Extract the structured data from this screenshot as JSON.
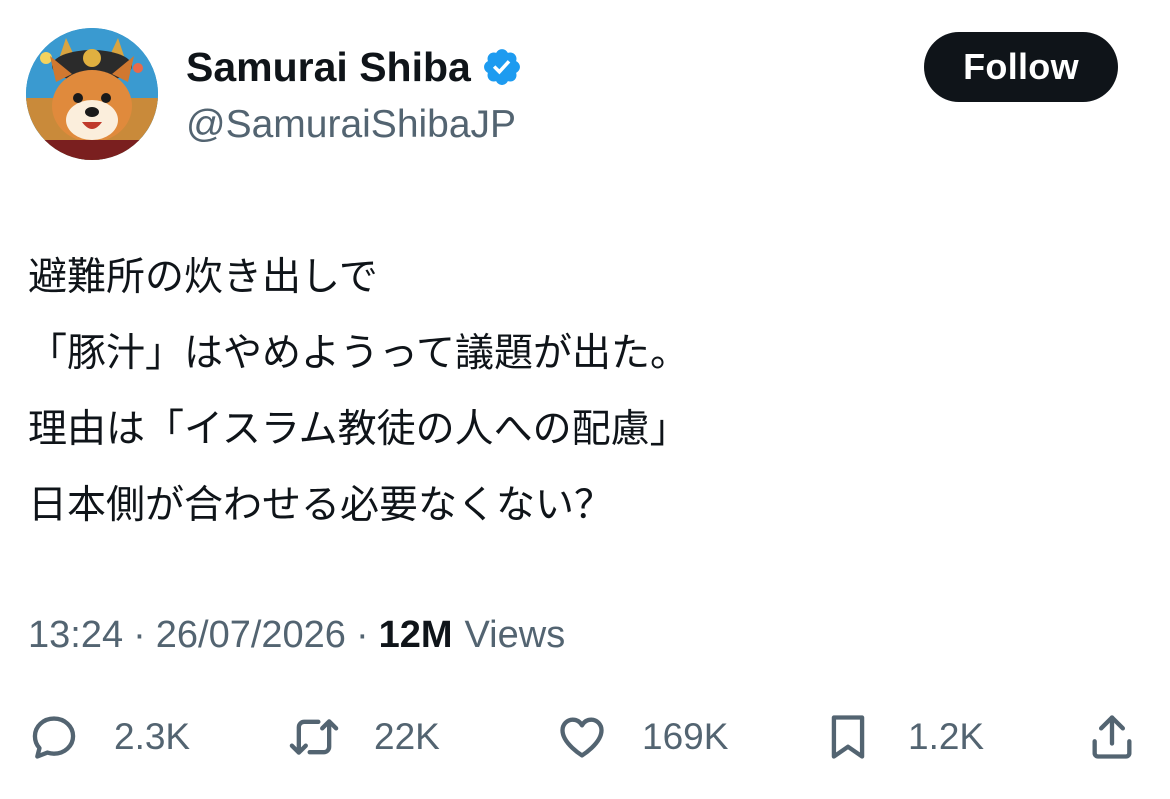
{
  "author": {
    "display_name": "Samurai Shiba",
    "handle": "@SamuraiShibaJP",
    "verified": true,
    "verified_color": "#1d9bf0"
  },
  "follow_button": {
    "label": "Follow"
  },
  "tweet": {
    "lines": [
      "避難所の炊き出しで",
      "「豚汁」はやめようって議題が出た。",
      "理由は「イスラム教徒の人への配慮」",
      "日本側が合わせる必要なくない？"
    ]
  },
  "meta": {
    "time": "13:24",
    "separator": "·",
    "date": "26/07/2026",
    "views_count": "12M",
    "views_label": "Views"
  },
  "actions": {
    "reply": {
      "icon": "reply-icon",
      "count": "2.3K"
    },
    "repost": {
      "icon": "repost-icon",
      "count": "22K"
    },
    "like": {
      "icon": "heart-icon",
      "count": "169K"
    },
    "bookmark": {
      "icon": "bookmark-icon",
      "count": "1.2K"
    },
    "share": {
      "icon": "share-icon"
    }
  },
  "colors": {
    "text_primary": "#0f1419",
    "text_secondary": "#536471",
    "button_bg": "#0f1419",
    "button_text": "#ffffff"
  }
}
